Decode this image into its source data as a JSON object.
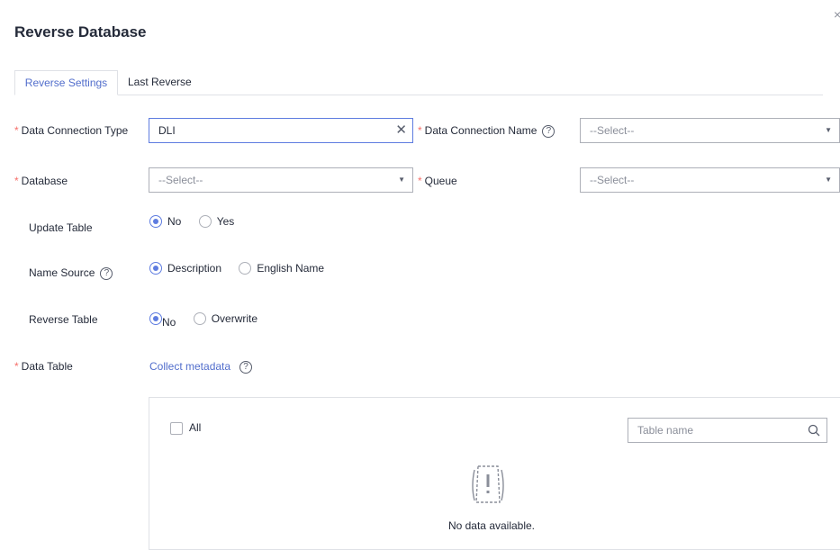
{
  "dialog": {
    "title": "Reverse Database",
    "close_symbol": "×"
  },
  "tabs": [
    {
      "label": "Reverse Settings",
      "active": true
    },
    {
      "label": "Last Reverse",
      "active": false
    }
  ],
  "form": {
    "data_connection_type": {
      "label": "Data Connection Type",
      "required": true,
      "value": "DLI",
      "clear_icon": "close-icon"
    },
    "data_connection_name": {
      "label": "Data Connection Name",
      "required": true,
      "placeholder": "--Select--"
    },
    "database": {
      "label": "Database",
      "required": true,
      "placeholder": "--Select--"
    },
    "queue": {
      "label": "Queue",
      "required": true,
      "placeholder": "--Select--"
    },
    "update_table": {
      "label": "Update Table",
      "options": [
        "No",
        "Yes"
      ],
      "selected": "No"
    },
    "name_source": {
      "label": "Name Source",
      "options": [
        "Description",
        "English Name"
      ],
      "selected": "Description"
    },
    "reverse_table": {
      "label": "Reverse Table",
      "options": [
        "No",
        "Overwrite"
      ],
      "selected": "No"
    },
    "data_table": {
      "label": "Data Table",
      "required": true,
      "link": "Collect metadata"
    }
  },
  "table_panel": {
    "select_all_label": "All",
    "search_placeholder": "Table name",
    "empty_text": "No data available."
  },
  "colors": {
    "accent": "#5e7ce0",
    "link": "#526ecc",
    "required": "#f66f6a",
    "border": "#adb0b8"
  }
}
